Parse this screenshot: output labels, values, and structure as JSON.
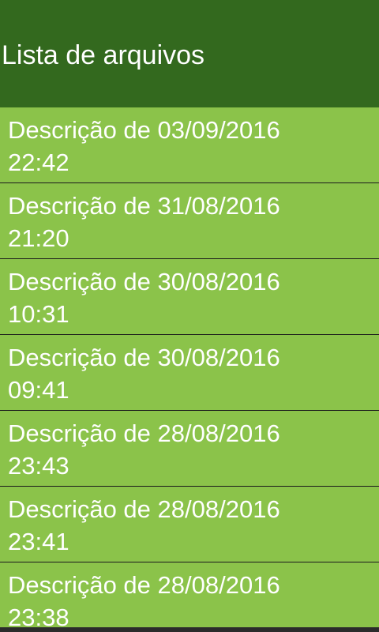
{
  "app_bar": {
    "title": "Lista de arquivos"
  },
  "files": [
    {
      "label": "Descrição de 03/09/2016 22:42"
    },
    {
      "label": "Descrição de 31/08/2016 21:20"
    },
    {
      "label": "Descrição de 30/08/2016 10:31"
    },
    {
      "label": "Descrição de 30/08/2016 09:41"
    },
    {
      "label": "Descrição de 28/08/2016 23:43"
    },
    {
      "label": "Descrição de 28/08/2016 23:41"
    },
    {
      "label": "Descrição de 28/08/2016 23:38"
    }
  ],
  "colors": {
    "app_bar": "#33691e",
    "list_item": "#8bc34a",
    "divider": "#1b1b1b",
    "text": "#ffffff"
  }
}
